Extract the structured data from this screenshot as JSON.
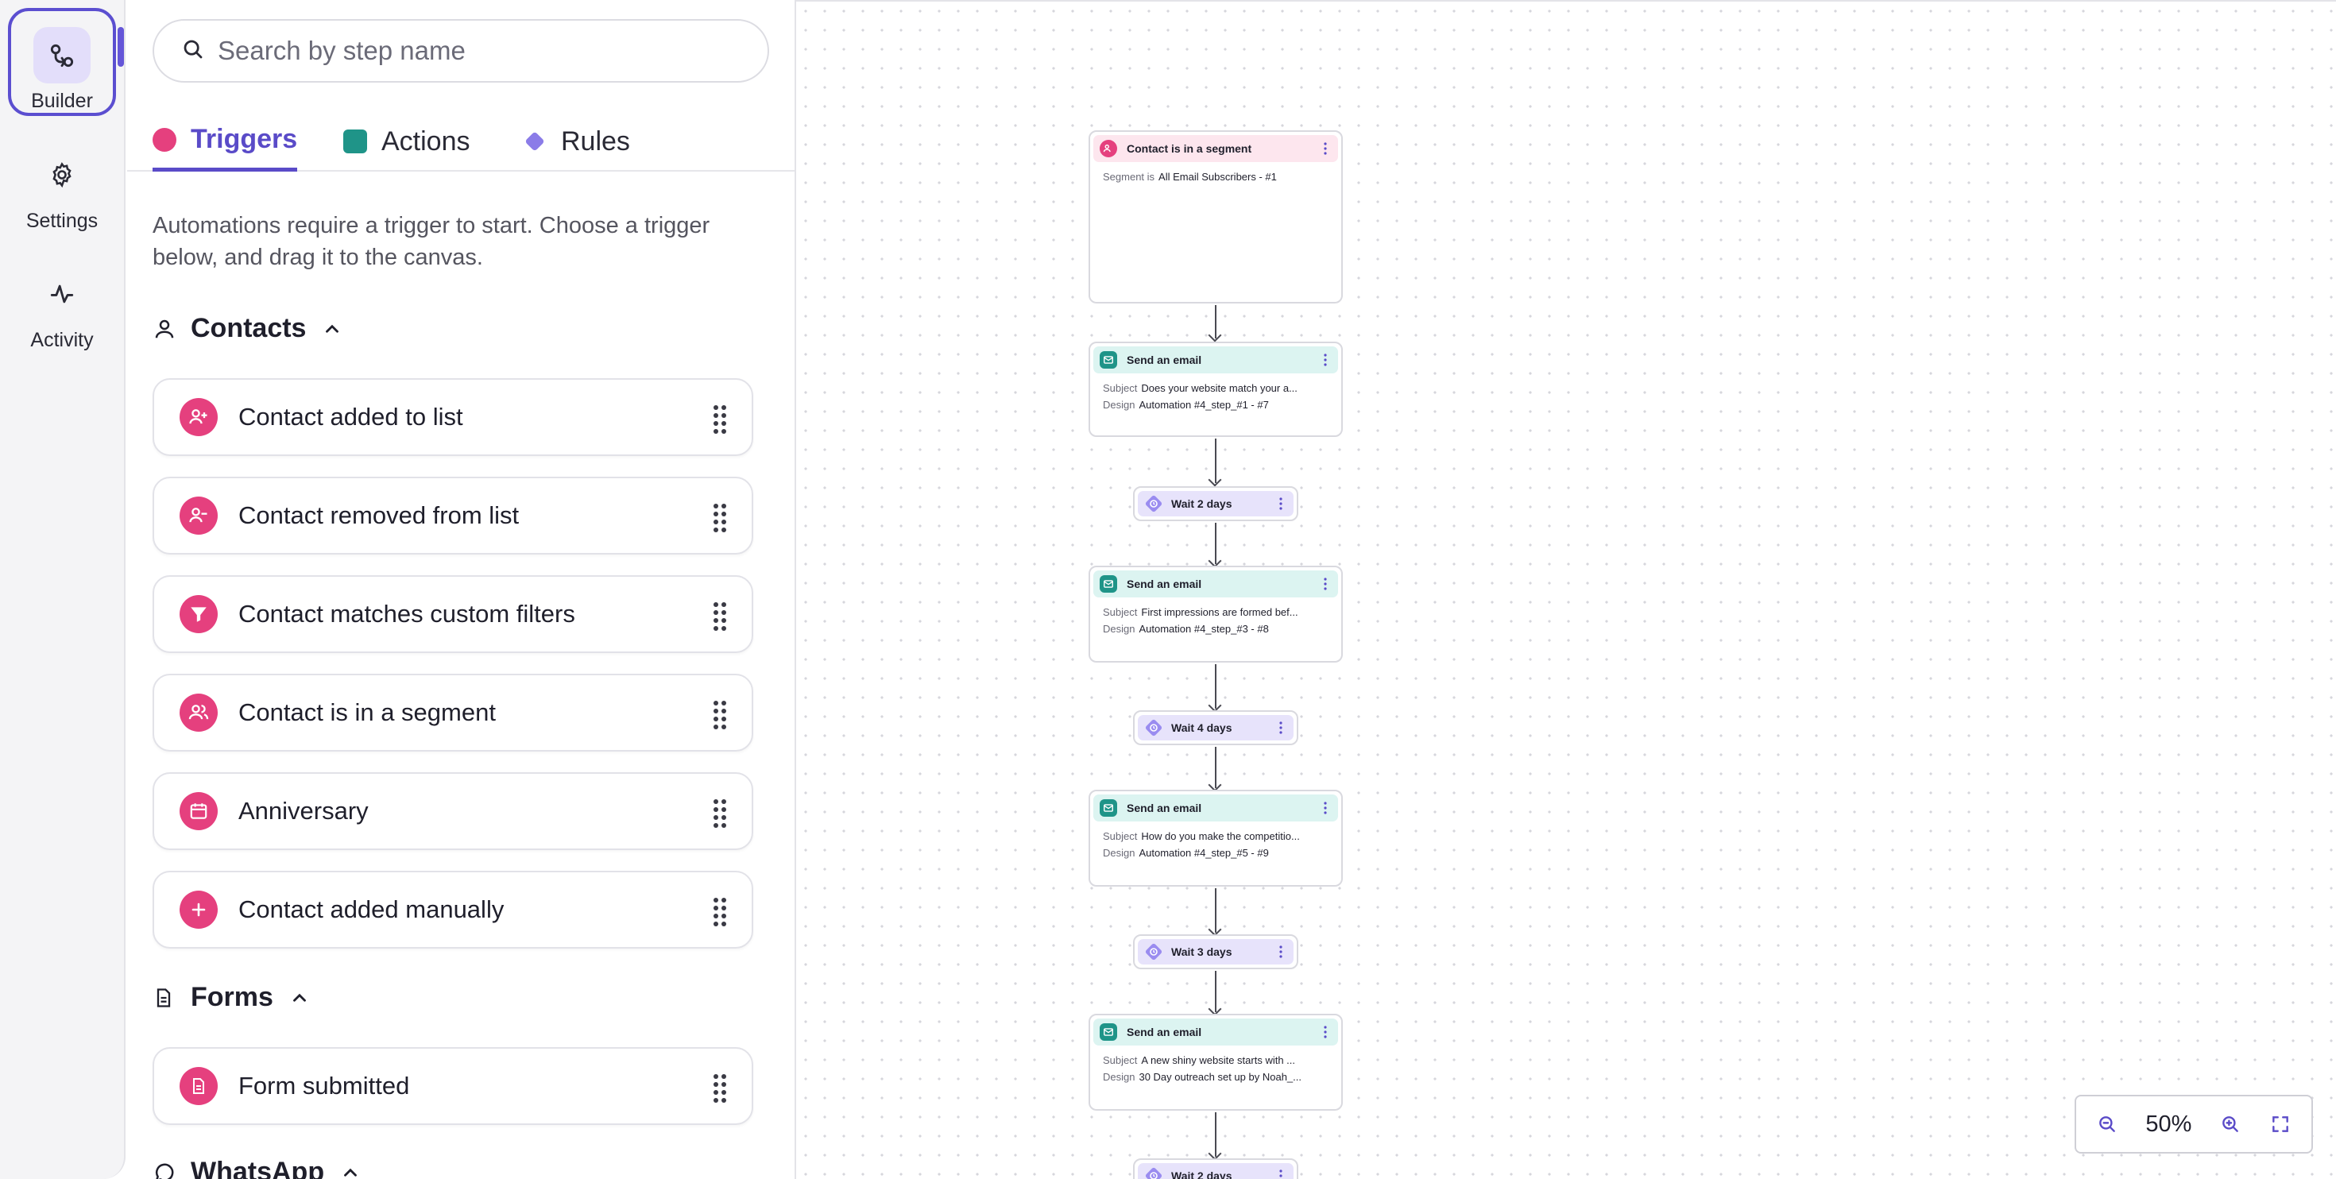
{
  "rail": {
    "items": [
      {
        "label": "Builder",
        "icon": "builder-icon",
        "active": true
      },
      {
        "label": "Settings",
        "icon": "gear-icon",
        "active": false
      },
      {
        "label": "Activity",
        "icon": "activity-icon",
        "active": false
      }
    ]
  },
  "search": {
    "placeholder": "Search by step name"
  },
  "tabs": [
    {
      "label": "Triggers",
      "color": "#e5407e",
      "active": true
    },
    {
      "label": "Actions",
      "color": "#1f9488",
      "active": false
    },
    {
      "label": "Rules",
      "color": "#8b7ce8",
      "active": false
    }
  ],
  "hint": "Automations require a trigger to start. Choose a trigger below, and drag it to the canvas.",
  "sections": {
    "contacts": {
      "title": "Contacts",
      "items": [
        {
          "label": "Contact added to list",
          "icon": "person-add-icon"
        },
        {
          "label": "Contact removed from list",
          "icon": "person-remove-icon"
        },
        {
          "label": "Contact matches custom filters",
          "icon": "filter-icon"
        },
        {
          "label": "Contact is in a segment",
          "icon": "people-icon"
        },
        {
          "label": "Anniversary",
          "icon": "calendar-icon"
        },
        {
          "label": "Contact added manually",
          "icon": "plus-icon"
        }
      ]
    },
    "forms": {
      "title": "Forms",
      "items": [
        {
          "label": "Form submitted",
          "icon": "form-icon"
        }
      ]
    },
    "whatsapp": {
      "title": "WhatsApp"
    }
  },
  "canvas": {
    "trigger": {
      "title": "Contact is in a segment",
      "key": "Segment is",
      "value": "All Email Subscribers - #1"
    },
    "emails": [
      {
        "title": "Send an email",
        "subject_key": "Subject",
        "subject": "Does your website match your a...",
        "design_key": "Design",
        "design": "Automation #4_step_#1 - #7"
      },
      {
        "title": "Send an email",
        "subject_key": "Subject",
        "subject": "First impressions are formed bef...",
        "design_key": "Design",
        "design": "Automation #4_step_#3 - #8"
      },
      {
        "title": "Send an email",
        "subject_key": "Subject",
        "subject": "How do you make the competitio...",
        "design_key": "Design",
        "design": "Automation #4_step_#5 - #9"
      },
      {
        "title": "Send an email",
        "subject_key": "Subject",
        "subject": "A new shiny website starts with ...",
        "design_key": "Design",
        "design": "30 Day outreach set up by Noah_..."
      }
    ],
    "waits": [
      {
        "label": "Wait 2 days"
      },
      {
        "label": "Wait 4 days"
      },
      {
        "label": "Wait 3 days"
      },
      {
        "label": "Wait 2 days"
      }
    ]
  },
  "zoom": {
    "value": "50%"
  },
  "colors": {
    "accent": "#5a4bc8",
    "trigger": "#e5407e",
    "action": "#1f9488",
    "rule": "#8b7ce8"
  }
}
